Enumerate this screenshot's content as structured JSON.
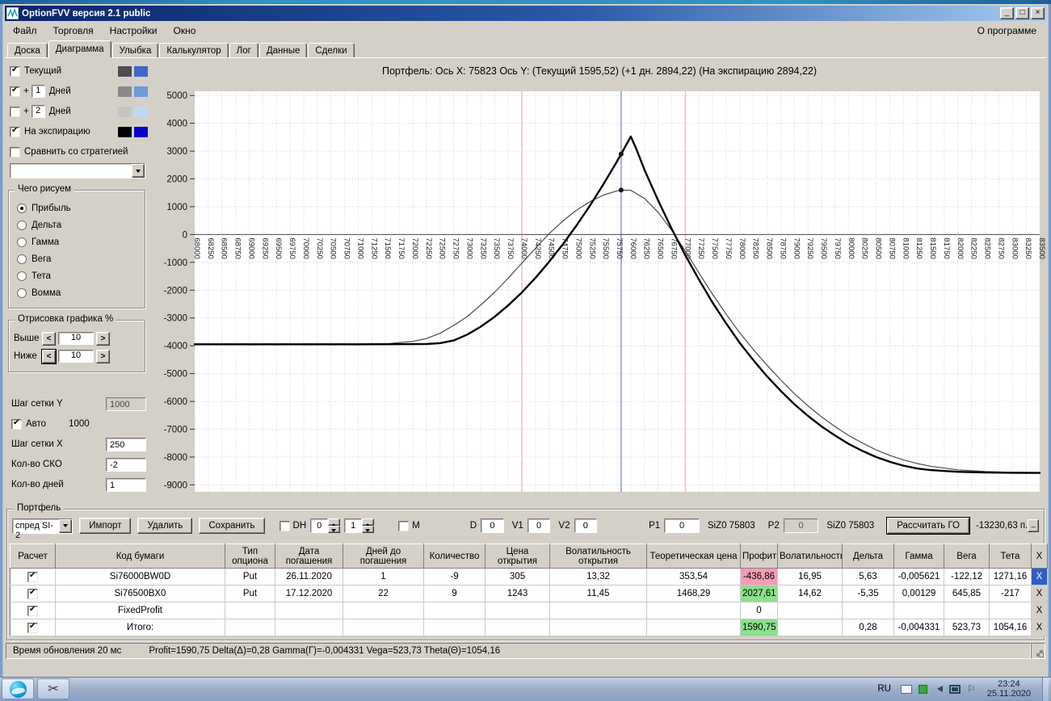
{
  "titlebar": {
    "title": "OptionFVV версия 2.1 public",
    "minimize": "_",
    "maximize": "□",
    "close": "×"
  },
  "menubar": {
    "items": [
      "Файл",
      "Торговля",
      "Настройки",
      "Окно"
    ],
    "right_item": "О программе"
  },
  "tabs": {
    "items": [
      "Доска",
      "Диаграмма",
      "Улыбка",
      "Калькулятор",
      "Лог",
      "Данные",
      "Сделки"
    ],
    "active": "Диаграмма"
  },
  "legend": {
    "rows": [
      {
        "checked": true,
        "prefix": "",
        "input": "",
        "label": "Текущий",
        "sw1": "#4d4d4d",
        "sw2": "#3f67c8"
      },
      {
        "checked": true,
        "prefix": "+",
        "input": "1",
        "label": "Дней",
        "sw1": "#8a8a8a",
        "sw2": "#6f9ad8"
      },
      {
        "checked": false,
        "prefix": "+",
        "input": "2",
        "label": "Дней",
        "sw1": "#c4c4c4",
        "sw2": "#bed8f4"
      },
      {
        "checked": true,
        "prefix": "",
        "input": "",
        "label": "На экспирацию",
        "sw1": "#000000",
        "sw2": "#0a00c8"
      }
    ],
    "compare": {
      "checked": false,
      "label": "Сравнить со стратегией"
    },
    "strategy_dropdown_value": ""
  },
  "draw_group": {
    "title": "Чего рисуем",
    "options": [
      "Прибыль",
      "Дельта",
      "Гамма",
      "Вега",
      "Тета",
      "Вомма"
    ],
    "selected": "Прибыль"
  },
  "render_pct_group": {
    "title": "Отрисовка графика %",
    "rows": [
      {
        "label": "Выше",
        "value": "10",
        "focus_left": false
      },
      {
        "label": "Ниже",
        "value": "10",
        "focus_left": true
      }
    ]
  },
  "grid_controls": {
    "y_label": "Шаг сетки Y",
    "y_value": "1000",
    "auto_label": "Авто",
    "auto_checked": true,
    "auto_value": "1000",
    "x_label": "Шаг сетки X",
    "x_value": "250",
    "sko_label": "Кол-во СКО",
    "sko_value": "-2",
    "days_label": "Кол-во дней",
    "days_value": "1"
  },
  "chart_data": {
    "type": "line",
    "title": "Портфель:  Ось X: 75823  Ось Y:   (Текущий 1595,52)   (+1 дн. 2894,22)   (На экспирацию 2894,22)",
    "xlim": [
      68000,
      83500
    ],
    "ylim": [
      -9250,
      5150
    ],
    "x_ticks": {
      "start": 68000,
      "end": 83500,
      "step": 250
    },
    "y_ticks": [
      5000,
      4000,
      3000,
      2000,
      1000,
      0,
      -1000,
      -2000,
      -3000,
      -4000,
      -5000,
      -6000,
      -7000,
      -8000,
      -9000
    ],
    "grid": true,
    "current_price_line": {
      "x": 75823,
      "color": "#8891bb"
    },
    "sigma_lines": {
      "xs": [
        74000,
        77000
      ],
      "color": "#f3bccd"
    },
    "markers": [
      {
        "x": 75823,
        "y": 2894.22
      },
      {
        "x": 75823,
        "y": 1595.52
      }
    ],
    "series": [
      {
        "name": "Текущий",
        "color": "#4a4a4a",
        "width": 1.2,
        "points": [
          [
            68000,
            -3952
          ],
          [
            69000,
            -3951
          ],
          [
            70000,
            -3950
          ],
          [
            70500,
            -3948
          ],
          [
            71000,
            -3944
          ],
          [
            71500,
            -3930
          ],
          [
            72000,
            -3840
          ],
          [
            72250,
            -3740
          ],
          [
            72500,
            -3550
          ],
          [
            72750,
            -3270
          ],
          [
            73000,
            -2950
          ],
          [
            73250,
            -2530
          ],
          [
            73500,
            -2080
          ],
          [
            73750,
            -1570
          ],
          [
            74000,
            -1030
          ],
          [
            74250,
            -500
          ],
          [
            74500,
            30
          ],
          [
            74750,
            480
          ],
          [
            75000,
            870
          ],
          [
            75250,
            1180
          ],
          [
            75500,
            1420
          ],
          [
            75750,
            1570
          ],
          [
            75823,
            1595
          ],
          [
            76000,
            1590
          ],
          [
            76250,
            1300
          ],
          [
            76500,
            800
          ],
          [
            76750,
            150
          ],
          [
            77000,
            -600
          ],
          [
            77250,
            -1380
          ],
          [
            77500,
            -2150
          ],
          [
            77750,
            -2870
          ],
          [
            78000,
            -3540
          ],
          [
            78250,
            -4140
          ],
          [
            78500,
            -4700
          ],
          [
            78750,
            -5230
          ],
          [
            79000,
            -5720
          ],
          [
            79250,
            -6160
          ],
          [
            79500,
            -6560
          ],
          [
            79750,
            -6910
          ],
          [
            80000,
            -7230
          ],
          [
            80250,
            -7500
          ],
          [
            80500,
            -7740
          ],
          [
            80750,
            -7940
          ],
          [
            81000,
            -8100
          ],
          [
            81250,
            -8230
          ],
          [
            81500,
            -8330
          ],
          [
            82000,
            -8460
          ],
          [
            82500,
            -8520
          ],
          [
            83000,
            -8550
          ],
          [
            83500,
            -8560
          ]
        ]
      },
      {
        "name": "На экспирацию",
        "color": "#000000",
        "width": 2.4,
        "points": [
          [
            68000,
            -3945
          ],
          [
            69000,
            -3945
          ],
          [
            70000,
            -3945
          ],
          [
            70500,
            -3945
          ],
          [
            71000,
            -3945
          ],
          [
            71500,
            -3944
          ],
          [
            72000,
            -3940
          ],
          [
            72250,
            -3935
          ],
          [
            72500,
            -3905
          ],
          [
            72750,
            -3810
          ],
          [
            73000,
            -3598
          ],
          [
            73250,
            -3310
          ],
          [
            73500,
            -2960
          ],
          [
            73750,
            -2548
          ],
          [
            74000,
            -2085
          ],
          [
            74250,
            -1560
          ],
          [
            74500,
            -985
          ],
          [
            74750,
            -360
          ],
          [
            75000,
            315
          ],
          [
            75250,
            1040
          ],
          [
            75500,
            1815
          ],
          [
            75750,
            2640
          ],
          [
            75823,
            2894
          ],
          [
            76000,
            3520
          ],
          [
            76100,
            3080
          ],
          [
            76250,
            2330
          ],
          [
            76500,
            1230
          ],
          [
            76750,
            200
          ],
          [
            77000,
            -750
          ],
          [
            77250,
            -1620
          ],
          [
            77500,
            -2450
          ],
          [
            77750,
            -3200
          ],
          [
            78000,
            -3900
          ],
          [
            78250,
            -4520
          ],
          [
            78500,
            -5100
          ],
          [
            78750,
            -5620
          ],
          [
            79000,
            -6100
          ],
          [
            79250,
            -6520
          ],
          [
            79500,
            -6900
          ],
          [
            79750,
            -7230
          ],
          [
            80000,
            -7530
          ],
          [
            80250,
            -7780
          ],
          [
            80500,
            -8000
          ],
          [
            80750,
            -8170
          ],
          [
            81000,
            -8310
          ],
          [
            81250,
            -8410
          ],
          [
            81500,
            -8470
          ],
          [
            82000,
            -8530
          ],
          [
            82500,
            -8555
          ],
          [
            83000,
            -8565
          ],
          [
            83500,
            -8570
          ]
        ]
      }
    ]
  },
  "portfolio": {
    "title": "Портфель",
    "preset": "спред SI-2",
    "import_btn": "Импорт",
    "delete_btn": "Удалить",
    "save_btn": "Сохранить",
    "dh_label": "DH",
    "dh_checked": false,
    "spin1": "0",
    "spin2": "1",
    "m_label": "M",
    "m_checked": false,
    "d_label": "D",
    "d_value": "0",
    "v1_label": "V1",
    "v1_value": "0",
    "v2_label": "V2",
    "v2_value": "0",
    "p1_label": "P1",
    "p1_value": "0",
    "si1": "SiZ0 75803",
    "p2_label": "P2",
    "p2_value": "0",
    "si2": "SiZ0 75803",
    "calc_btn": "Рассчитать ГО",
    "go_value": "-13230,63 п.",
    "corner_btn": "_",
    "table": {
      "headers": [
        "Расчет",
        "Код бумаги",
        "Тип опциона",
        "Дата погашения",
        "Дней до погашения",
        "Количество",
        "Цена открытия",
        "Волатильность открытия",
        "Теоретическая цена",
        "Профит",
        "Волатильность",
        "Дельта",
        "Гамма",
        "Вега",
        "Тета",
        "X"
      ],
      "rows": [
        {
          "checked": true,
          "code": "Si76000BW0D",
          "type": "Put",
          "date": "26.11.2020",
          "days": "1",
          "qty": "-9",
          "price": "305",
          "vol_open": "13,32",
          "theor": "353,54",
          "profit": "-436,86",
          "profit_bg": "#f49db4",
          "vol": "16,95",
          "delta": "5,63",
          "gamma": "-0,005621",
          "vega": "-122,12",
          "theta": "1271,16",
          "x": "X",
          "x_selected": true
        },
        {
          "checked": true,
          "code": "Si76500BX0",
          "type": "Put",
          "date": "17.12.2020",
          "days": "22",
          "qty": "9",
          "price": "1243",
          "vol_open": "11,45",
          "theor": "1468,29",
          "profit": "2027,61",
          "profit_bg": "#8ce08c",
          "vol": "14,62",
          "delta": "-5,35",
          "gamma": "0,00129",
          "vega": "645,85",
          "theta": "-217",
          "x": "X",
          "x_selected": false
        },
        {
          "checked": true,
          "code": "FixedProfit",
          "type": "",
          "date": "",
          "days": "",
          "qty": "",
          "price": "",
          "vol_open": "",
          "theor": "",
          "profit": "0",
          "profit_bg": "",
          "vol": "",
          "delta": "",
          "gamma": "",
          "vega": "",
          "theta": "",
          "x": "X",
          "x_selected": false
        },
        {
          "checked": true,
          "code": "Итого:",
          "type": "",
          "date": "",
          "days": "",
          "qty": "",
          "price": "",
          "vol_open": "",
          "theor": "",
          "profit": "1590,75",
          "profit_bg": "#8ce08c",
          "vol": "",
          "delta": "0,28",
          "gamma": "-0,004331",
          "vega": "523,73",
          "theta": "1054,16",
          "x": "X",
          "x_selected": false
        }
      ]
    }
  },
  "statusbar": {
    "left": "Время обновления 20 мс",
    "right": "Profit=1590,75 Delta(Δ)=0,28 Gamma(Γ)=-0,004331 Vega=523,73 Theta(Θ)=1054,16"
  },
  "taskbar": {
    "lang": "RU",
    "time": "23:24",
    "date": "25.11.2020"
  }
}
